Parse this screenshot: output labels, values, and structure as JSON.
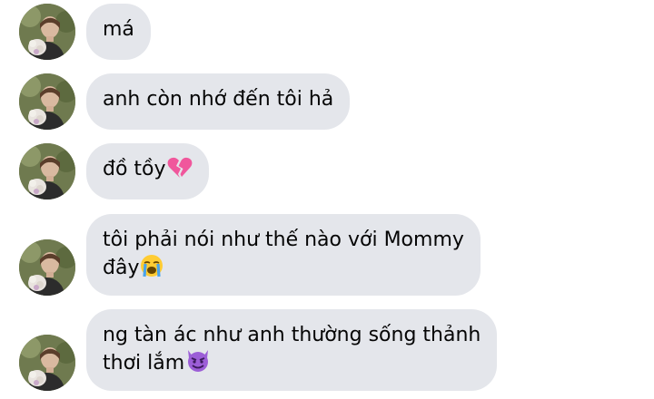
{
  "conversation": {
    "messages": [
      {
        "sender_avatar": "profile-photo",
        "lines": [
          "má"
        ],
        "emoji": null
      },
      {
        "sender_avatar": "profile-photo",
        "lines": [
          "anh còn nhớ đến tôi hả"
        ],
        "emoji": null
      },
      {
        "sender_avatar": "profile-photo",
        "lines": [
          "đồ tồy"
        ],
        "emoji": "broken-heart-icon"
      },
      {
        "sender_avatar": "profile-photo",
        "lines": [
          "tôi phải nói như thế nào với Mommy",
          "đây"
        ],
        "emoji": "loudly-crying-face-icon"
      },
      {
        "sender_avatar": "profile-photo",
        "lines": [
          "ng tàn ác như anh thường sống thảnh",
          "thơi lắm"
        ],
        "emoji": "smiling-face-with-horns-icon"
      }
    ]
  },
  "colors": {
    "bubble_background": "#e4e6eb",
    "text": "#050505",
    "page_background": "#ffffff"
  }
}
